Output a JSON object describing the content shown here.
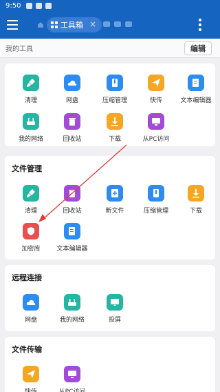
{
  "status": {
    "time": "9:50"
  },
  "appbar": {
    "tab_label": "工具箱",
    "close_glyph": "×"
  },
  "toolsbar": {
    "label": "我的工具",
    "edit_label": "编辑"
  },
  "colors": {
    "primary": "#1565c0",
    "teal": "#26b5a3",
    "blue": "#2d8cf0",
    "orange": "#f5a623",
    "purple": "#a24bd6",
    "red": "#e8504f"
  },
  "my_tools": [
    {
      "label": "清理",
      "icon": "broom-icon"
    },
    {
      "label": "网盘",
      "icon": "cloud-icon"
    },
    {
      "label": "压缩管理",
      "icon": "archive-icon"
    },
    {
      "label": "快传",
      "icon": "paper-plane-icon"
    },
    {
      "label": "文本编辑器",
      "icon": "text-editor-icon"
    },
    {
      "label": "我的网络",
      "icon": "router-icon"
    },
    {
      "label": "回收站",
      "icon": "trash-icon"
    },
    {
      "label": "下载",
      "icon": "download-icon"
    },
    {
      "label": "从PC访问",
      "icon": "pc-icon"
    }
  ],
  "file_mgmt": {
    "title": "文件管理",
    "items": [
      {
        "label": "清理",
        "icon": "broom-icon"
      },
      {
        "label": "回收站",
        "icon": "trash-icon"
      },
      {
        "label": "新文件",
        "icon": "new-file-icon"
      },
      {
        "label": "压缩管理",
        "icon": "archive-icon"
      },
      {
        "label": "下载",
        "icon": "download-icon"
      },
      {
        "label": "加密库",
        "icon": "shield-icon"
      },
      {
        "label": "文本编辑器",
        "icon": "text-editor-icon"
      }
    ]
  },
  "remote": {
    "title": "远程连接",
    "items": [
      {
        "label": "网盘",
        "icon": "cloud-icon"
      },
      {
        "label": "我的网络",
        "icon": "router-icon"
      },
      {
        "label": "投屏",
        "icon": "cast-icon"
      }
    ]
  },
  "transfer": {
    "title": "文件传输",
    "items": [
      {
        "label": "快传",
        "icon": "paper-plane-icon"
      },
      {
        "label": "从PC访问",
        "icon": "pc-icon"
      }
    ]
  }
}
